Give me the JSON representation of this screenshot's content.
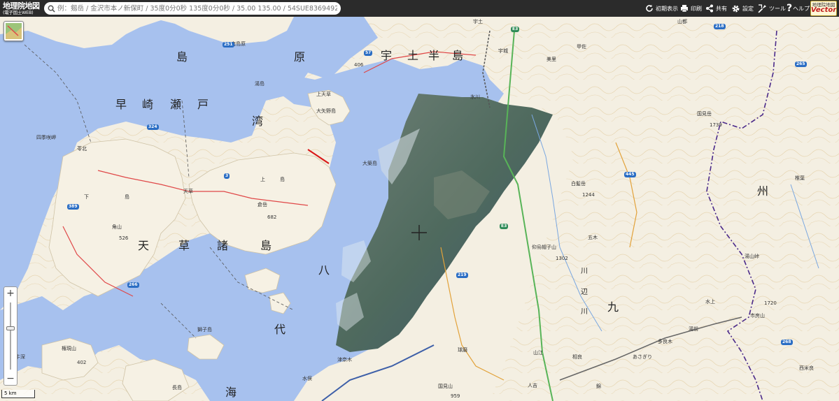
{
  "header": {
    "logo_title": "地理院地図",
    "logo_subtitle": "(電子国土WEB)",
    "search_placeholder": "例：剱岳 / 金沢市本ノ新保町 / 35度0分0秒 135度0分0秒 / 35.00 135.00 / 54SUE83694920",
    "buttons": {
      "initial_view": "初期表示",
      "print": "印刷",
      "share": "共有",
      "settings": "設定",
      "tools": "ツール",
      "help": "ヘルプ"
    },
    "vector_badge": {
      "line1": "地理院地図",
      "line2": "Vector"
    }
  },
  "controls": {
    "zoom_in": "+",
    "zoom_out": "−",
    "scale": "5 km"
  },
  "map": {
    "sea_labels": [
      "早",
      "崎",
      "瀬",
      "戸",
      "湾",
      "天",
      "草",
      "諸",
      "島",
      "原",
      "八",
      "代",
      "海",
      "宇",
      "土",
      "半",
      "島"
    ],
    "land_labels": [
      "九",
      "州",
      "川",
      "辺",
      "川"
    ],
    "places": {
      "p1": "南島原",
      "p2": "湯島",
      "p3": "上天草",
      "p4": "大矢野島",
      "p5": "四季咲岬",
      "p6": "苓北",
      "p7": "天草",
      "p8": "倉岳",
      "p9": "682",
      "p10": "角山",
      "p11": "526",
      "p12": "大築島",
      "p13": "獅子島",
      "p14": "権現山",
      "p15": "402",
      "p16": "長島",
      "p17": "津奈木",
      "p18": "水俣",
      "p19": "国見山",
      "p20": "959",
      "p21": "球磨",
      "p22": "山江",
      "p23": "人吉",
      "p24": "錦",
      "p25": "相良",
      "p26": "あさぎり",
      "p27": "多良木",
      "p28": "湯前",
      "p29": "水上",
      "p30": "市房山",
      "p31": "1720",
      "p32": "湯山峠",
      "p33": "1739",
      "p34": "国見岳",
      "p35": "椎葉",
      "p36": "五木",
      "p37": "白髪岳",
      "p38": "1244",
      "p39": "仰烏帽子山",
      "p40": "1302",
      "p41": "甲佐",
      "p42": "美里",
      "p43": "山都",
      "p44": "宇土",
      "p45": "宇城",
      "p46": "氷川",
      "p47": "西米良",
      "p48": "406",
      "p49": "下",
      "p50": "島",
      "p51": "上",
      "p52": "島",
      "p53": "牛深"
    },
    "roads": [
      "251",
      "324",
      "389",
      "266",
      "57",
      "445",
      "265",
      "218",
      "268",
      "219",
      "3",
      "E3",
      "E3"
    ]
  }
}
